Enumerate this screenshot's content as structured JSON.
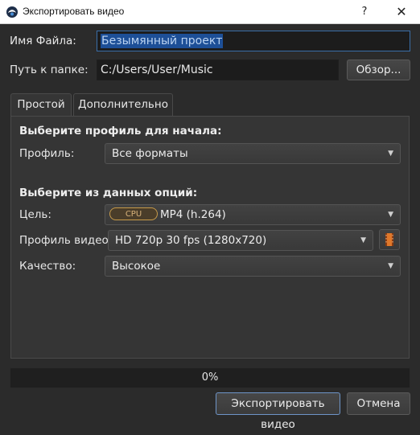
{
  "window": {
    "title": "Экспортировать видео",
    "help_glyph": "?",
    "close_glyph": "✕"
  },
  "form": {
    "filename_label": "Имя Файла:",
    "filename_value": "Безымянный проект",
    "path_label": "Путь к папке:",
    "path_value": "C:/Users/User/Music",
    "browse_label": "Обзор..."
  },
  "tabs": [
    {
      "label": "Простой",
      "active": true
    },
    {
      "label": "Дополнительно",
      "active": false
    }
  ],
  "simple": {
    "profile_section_title": "Выберите профиль для начала:",
    "profile_label": "Профиль:",
    "profile_value": "Все форматы",
    "options_section_title": "Выберите из данных опций:",
    "target_label": "Цель:",
    "target_badge": "CPU",
    "target_value": "MP4 (h.264)",
    "video_profile_label": "Профиль видео:",
    "video_profile_value": "HD 720p 30 fps (1280x720)",
    "quality_label": "Качество:",
    "quality_value": "Высокое"
  },
  "progress": {
    "text": "0%",
    "fraction": 0
  },
  "buttons": {
    "export_label": "Экспортировать видео",
    "cancel_label": "Отмена"
  },
  "icons": {
    "app": "openshot-logo-icon",
    "help": "help-icon",
    "close": "close-icon",
    "dropdown": "chevron-down-icon",
    "video_profile": "film-strip-icon"
  },
  "colors": {
    "background": "#2b2b2b",
    "panel": "#353535",
    "selection": "#1d4f97",
    "accent_border": "#6e95c8",
    "cpu_badge": "#c79a4a"
  }
}
